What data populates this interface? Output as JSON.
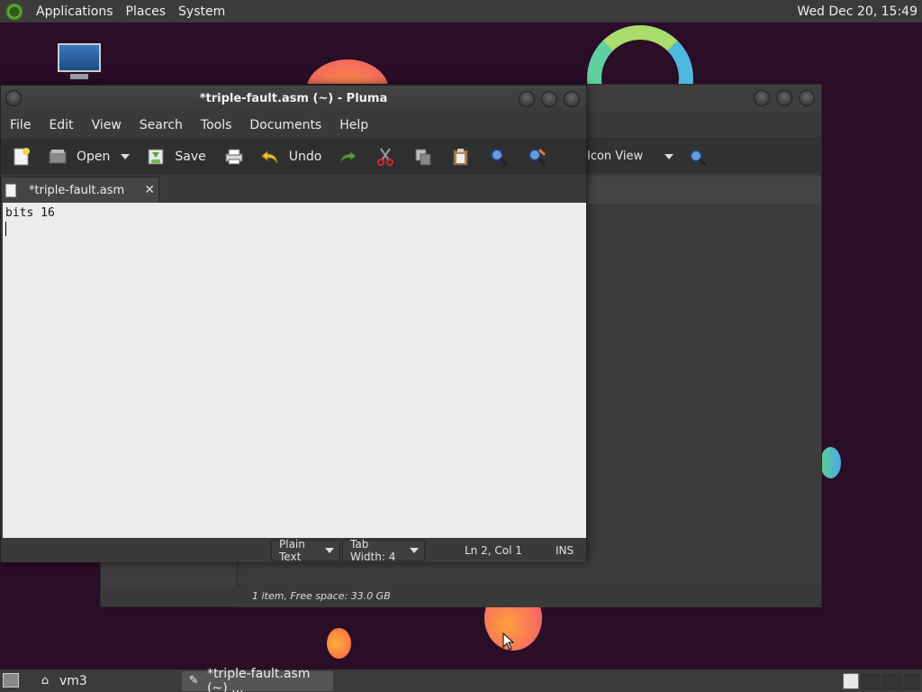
{
  "top_panel": {
    "menus": [
      "Applications",
      "Places",
      "System"
    ],
    "clock": "Wed Dec 20, 15:49"
  },
  "file_manager": {
    "view_label": "Icon View",
    "status": "1 item, Free space: 33.0 GB"
  },
  "pluma": {
    "title": "*triple-fault.asm (~) - Pluma",
    "menu": [
      "File",
      "Edit",
      "View",
      "Search",
      "Tools",
      "Documents",
      "Help"
    ],
    "toolbar": {
      "open_label": "Open",
      "save_label": "Save",
      "undo_label": "Undo"
    },
    "tab": {
      "label": "*triple-fault.asm"
    },
    "editor": {
      "line1": "bits 16"
    },
    "statusbar": {
      "language": "Plain Text",
      "tab_width": "Tab Width:  4",
      "position": "Ln 2, Col 1",
      "mode": "INS"
    }
  },
  "bottom_panel": {
    "tasks": [
      {
        "label": "vm3",
        "icon": "home-folder-icon"
      },
      {
        "label": "*triple-fault.asm (~) ...",
        "icon": "text-editor-icon"
      }
    ]
  }
}
